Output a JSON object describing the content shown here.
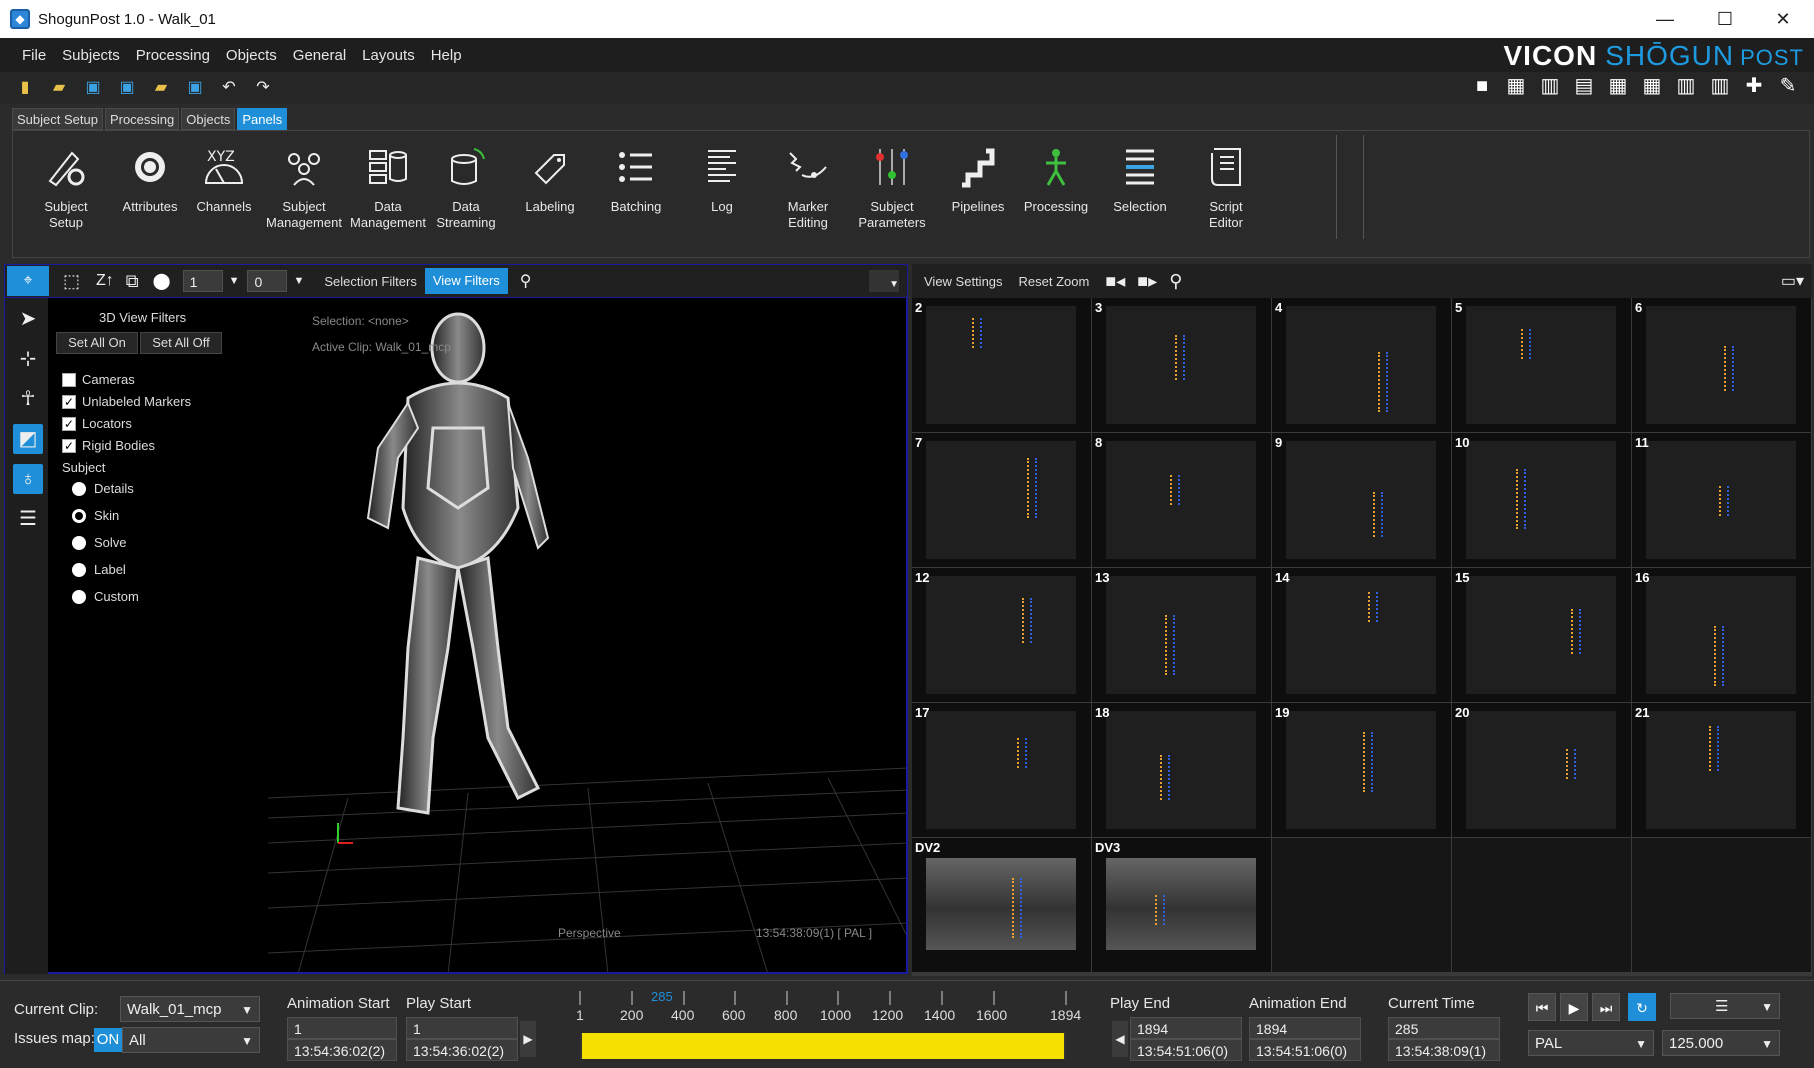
{
  "window": {
    "title": "ShogunPost 1.0  -  Walk_01",
    "minimize": "—",
    "maximize": "☐",
    "close": "✕"
  },
  "menu": [
    "File",
    "Subjects",
    "Processing",
    "Objects",
    "General",
    "Layouts",
    "Help"
  ],
  "brand": {
    "part1": "VICON",
    "part2": "SHŌGUN",
    "part3": "POST"
  },
  "ribbon_tabs": [
    {
      "label": "Subject Setup",
      "active": false
    },
    {
      "label": "Processing",
      "active": false
    },
    {
      "label": "Objects",
      "active": false
    },
    {
      "label": "Panels",
      "active": true
    }
  ],
  "ribbon": [
    {
      "label": "Subject\nSetup",
      "icon": "subject-setup-icon"
    },
    {
      "label": "Attributes",
      "icon": "gear-icon"
    },
    {
      "label": "Channels",
      "icon": "channels-icon"
    },
    {
      "label": "Subject\nManagement",
      "icon": "people-icon"
    },
    {
      "label": "Data\nManagement",
      "icon": "data-management-icon"
    },
    {
      "label": "Data\nStreaming",
      "icon": "database-icon"
    },
    {
      "label": "Labeling",
      "icon": "tag-icon"
    },
    {
      "label": "Batching",
      "icon": "list-icon"
    },
    {
      "label": "Log",
      "icon": "log-icon"
    },
    {
      "label": "Marker\nEditing",
      "icon": "marker-editing-icon"
    },
    {
      "label": "Subject\nParameters",
      "icon": "sliders-icon"
    },
    {
      "label": "Pipelines",
      "icon": "pipeline-icon"
    },
    {
      "label": "Processing",
      "icon": "figure-icon"
    },
    {
      "label": "Selection",
      "icon": "selection-icon"
    },
    {
      "label": "Script\nEditor",
      "icon": "script-icon"
    }
  ],
  "viewport": {
    "field1": "1",
    "field2": "0",
    "selection_filters": "Selection Filters",
    "view_filters": "View Filters",
    "filters_title": "3D View Filters",
    "set_all_on": "Set All On",
    "set_all_off": "Set All Off",
    "checks": [
      {
        "label": "Cameras",
        "checked": false
      },
      {
        "label": "Unlabeled Markers",
        "checked": true
      },
      {
        "label": "Locators",
        "checked": true
      },
      {
        "label": "Rigid Bodies",
        "checked": true
      }
    ],
    "subject_label": "Subject",
    "radios": [
      {
        "label": "Details",
        "on": false
      },
      {
        "label": "Skin",
        "on": true
      },
      {
        "label": "Solve",
        "on": false
      },
      {
        "label": "Label",
        "on": false
      },
      {
        "label": "Custom",
        "on": false
      }
    ],
    "selection_text": "Selection: <none>",
    "active_clip_text": "Active Clip: Walk_01_mcp",
    "camera_label": "Perspective",
    "timecode": "13:54:38:09(1) [ PAL ]"
  },
  "camera_panel": {
    "view_settings": "View Settings",
    "reset_zoom": "Reset Zoom",
    "cells": [
      "2",
      "3",
      "4",
      "5",
      "6",
      "7",
      "8",
      "9",
      "10",
      "11",
      "12",
      "13",
      "14",
      "15",
      "16",
      "17",
      "18",
      "19",
      "20",
      "21",
      "DV2",
      "DV3",
      "",
      "",
      ""
    ]
  },
  "bottom": {
    "current_clip_label": "Current Clip:",
    "current_clip": "Walk_01_mcp",
    "issues_label": "Issues map:",
    "issues_on": "ON",
    "issues_value": "All",
    "anim_start_label": "Animation Start",
    "anim_start_frame": "1",
    "anim_start_tc": "13:54:36:02(2)",
    "play_start_label": "Play Start",
    "play_start_frame": "1",
    "play_start_tc": "13:54:36:02(2)",
    "timeline_marker": "285",
    "timeline_ticks": [
      "1",
      "200",
      "400",
      "600",
      "800",
      "1000",
      "1200",
      "1400",
      "1600",
      "1894"
    ],
    "play_end_label": "Play End",
    "play_end_frame": "1894",
    "play_end_tc": "13:54:51:06(0)",
    "anim_end_label": "Animation End",
    "anim_end_frame": "1894",
    "anim_end_tc": "13:54:51:06(0)",
    "current_time_label": "Current Time",
    "current_time_frame": "285",
    "current_time_tc": "13:54:38:09(1)",
    "rate_system": "PAL",
    "rate_value": "125.000"
  }
}
